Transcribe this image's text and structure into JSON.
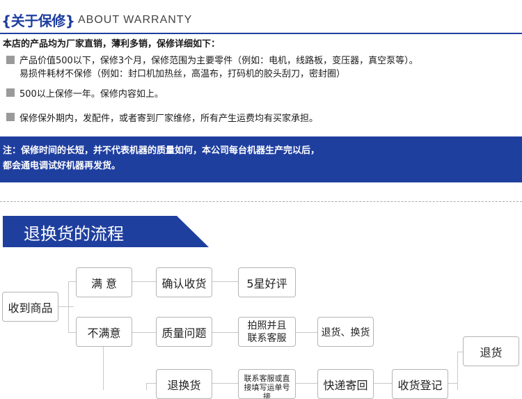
{
  "header": {
    "title_cn": "{关于保修}",
    "title_en": "ABOUT WARRANTY",
    "accent_color": "#1f3f9f"
  },
  "warranty": {
    "intro": "本店的产品均为厂家直销，薄利多销，保修详细如下：",
    "items": [
      {
        "line1": "产品价值500以下，保修3个月，保修范围为主要零件（例如：电机，线路板，变压器，真空泵等）。",
        "line2": "易损件耗材不保修（例如：封口机加热丝，高温布，打码机的胶头刮刀，密封圈）"
      },
      {
        "line1": "500以上保修一年。保修内容如上。"
      },
      {
        "line1": "保修保外期内，发配件，或者寄到厂家维修，所有产生运费均有买家承担。"
      }
    ]
  },
  "notice": {
    "line1": "注：保修时间的长短，并不代表机器的质量如何，本公司每台机器生产完以后，",
    "line2": "都会通电调试好机器再发货。"
  },
  "process": {
    "banner_title": "退换货的流程",
    "nodes": {
      "receive": "收到商品",
      "satisfied": "满 意",
      "confirm": "确认收货",
      "five_star": "5星好评",
      "unsatisfied": "不满意",
      "quality_issue": "质量问题",
      "photo_contact": "拍照并且联系客服",
      "return_exchange": "退货、换货",
      "return_goods": "退换货",
      "contact_direct": "联系客服或直接填写运单号接",
      "express_back": "快递寄回",
      "receipt_register": "收货登记",
      "refund": "退货"
    }
  }
}
